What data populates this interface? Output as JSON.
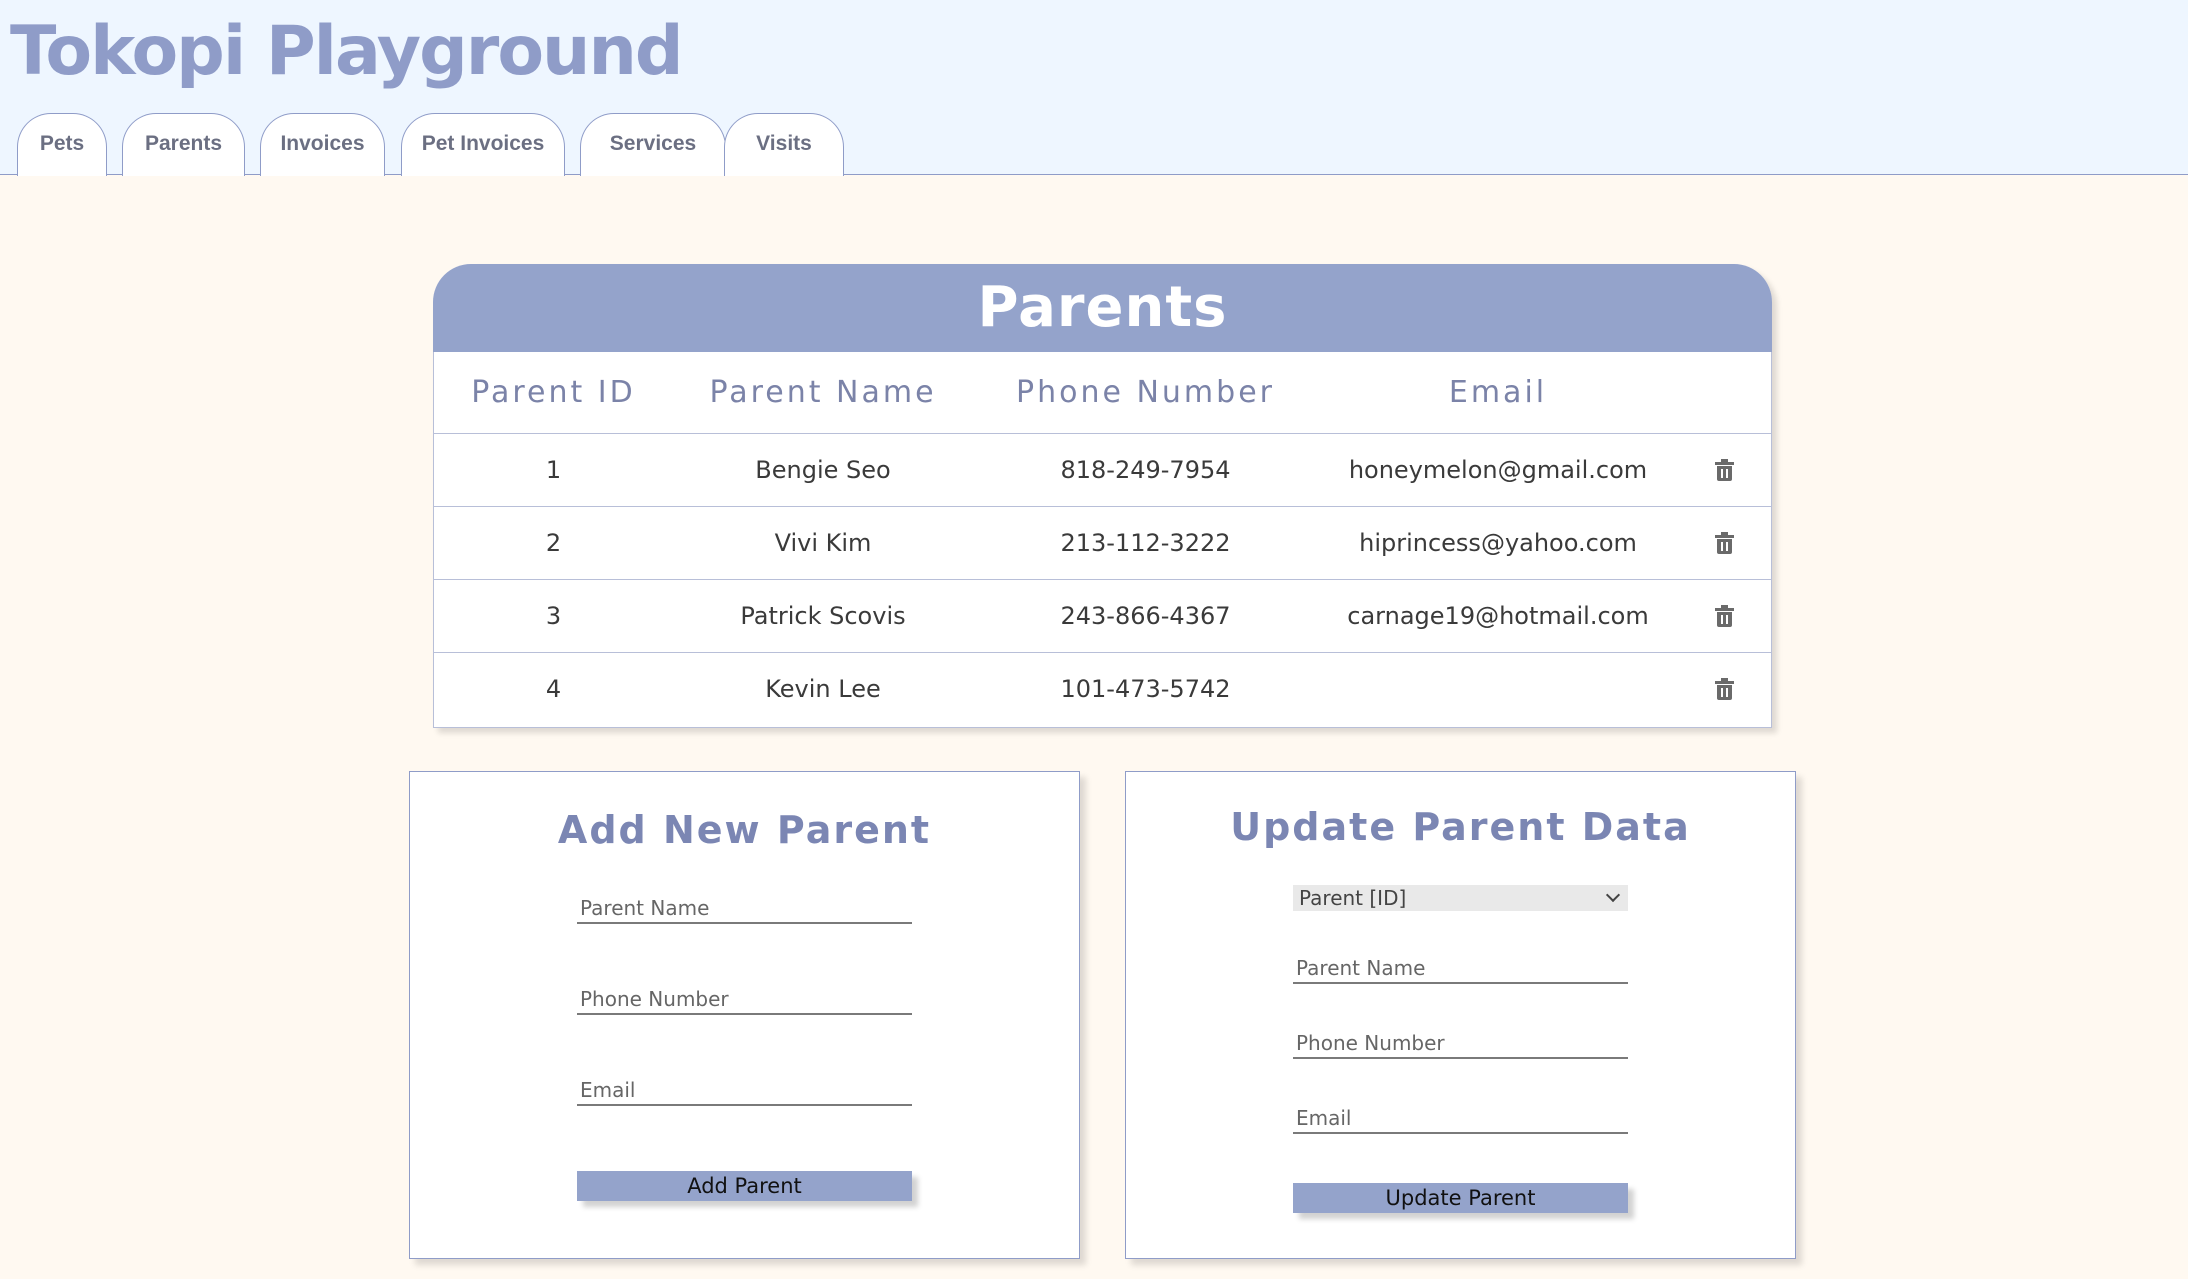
{
  "app": {
    "title": "Tokopi Playground"
  },
  "nav": {
    "tabs": [
      {
        "label": "Pets"
      },
      {
        "label": "Parents"
      },
      {
        "label": "Invoices"
      },
      {
        "label": "Pet Invoices"
      },
      {
        "label": "Services"
      },
      {
        "label": "Visits"
      }
    ]
  },
  "table": {
    "title": "Parents",
    "columns": [
      "Parent ID",
      "Parent Name",
      "Phone Number",
      "Email"
    ],
    "rows": [
      {
        "id": "1",
        "name": "Bengie Seo",
        "phone": "818-249-7954",
        "email": "honeymelon@gmail.com"
      },
      {
        "id": "2",
        "name": "Vivi Kim",
        "phone": "213-112-3222",
        "email": "hiprincess@yahoo.com"
      },
      {
        "id": "3",
        "name": "Patrick Scovis",
        "phone": "243-866-4367",
        "email": "carnage19@hotmail.com"
      },
      {
        "id": "4",
        "name": "Kevin Lee",
        "phone": "101-473-5742",
        "email": ""
      }
    ],
    "delete_icon": "trash-icon"
  },
  "add_form": {
    "title": "Add New Parent",
    "name_placeholder": "Parent Name",
    "phone_placeholder": "Phone Number",
    "email_placeholder": "Email",
    "submit_label": "Add Parent"
  },
  "update_form": {
    "title": "Update Parent Data",
    "select_value": "Parent [ID]",
    "name_placeholder": "Parent Name",
    "phone_placeholder": "Phone Number",
    "email_placeholder": "Email",
    "submit_label": "Update Parent"
  },
  "colors": {
    "accent": "#94a3cb",
    "title": "#8f9cc8",
    "header_bg": "#eef6ff",
    "page_bg": "#fff9f1"
  }
}
